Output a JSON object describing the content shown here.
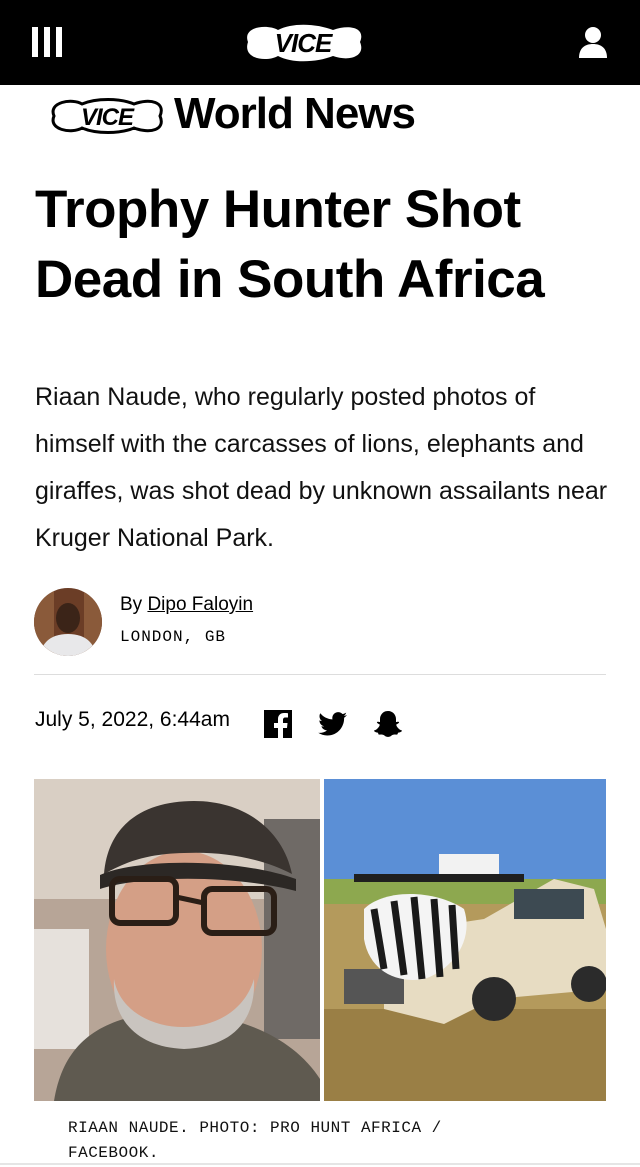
{
  "header": {
    "logo_text": "VICE",
    "menu_icon": "hamburger-menu-icon",
    "user_icon": "user-account-icon"
  },
  "section": {
    "logo_text": "VICE",
    "name": "World News"
  },
  "article": {
    "headline": "Trophy Hunter Shot Dead in South Africa",
    "dek": "Riaan Naude, who regularly posted photos of himself with the carcasses of lions, elephants and giraffes, was shot dead by unknown assailants near Kruger National Park.",
    "byline_prefix": "By ",
    "author": "Dipo Faloyin",
    "location": "LONDON, GB",
    "date": "July 5, 2022, 6:44am",
    "share_icons": [
      "facebook-icon",
      "twitter-icon",
      "snapchat-icon"
    ],
    "caption": "RIAAN NAUDE. PHOTO: PRO HUNT AFRICA / FACEBOOK."
  },
  "colors": {
    "topbar": "#000000",
    "text": "#000000",
    "divider": "#dddddd"
  }
}
